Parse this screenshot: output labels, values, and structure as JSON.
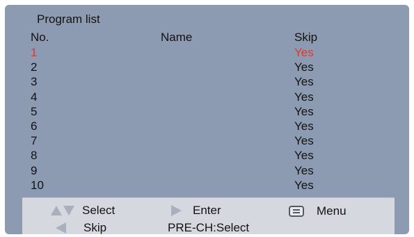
{
  "screen": {
    "title": "Program list",
    "columns": {
      "no": "No.",
      "name": "Name",
      "skip": "Skip"
    },
    "selected_row": 0,
    "accent_color": "#d83a2e",
    "rows": [
      {
        "no": "1",
        "name": "",
        "skip": "Yes"
      },
      {
        "no": "2",
        "name": "",
        "skip": "Yes"
      },
      {
        "no": "3",
        "name": "",
        "skip": "Yes"
      },
      {
        "no": "4",
        "name": "",
        "skip": "Yes"
      },
      {
        "no": "5",
        "name": "",
        "skip": "Yes"
      },
      {
        "no": "6",
        "name": "",
        "skip": "Yes"
      },
      {
        "no": "7",
        "name": "",
        "skip": "Yes"
      },
      {
        "no": "8",
        "name": "",
        "skip": "Yes"
      },
      {
        "no": "9",
        "name": "",
        "skip": "Yes"
      },
      {
        "no": "10",
        "name": "",
        "skip": "Yes"
      }
    ]
  },
  "hints": {
    "select": {
      "icon": "up-down-arrows-icon",
      "label": "Select"
    },
    "enter": {
      "icon": "right-arrow-icon",
      "label": "Enter"
    },
    "menu": {
      "icon": "menu-icon",
      "label": "Menu"
    },
    "skip": {
      "icon": "left-arrow-icon",
      "label": "Skip"
    },
    "prech": {
      "label": "PRE-CH:Select"
    }
  }
}
